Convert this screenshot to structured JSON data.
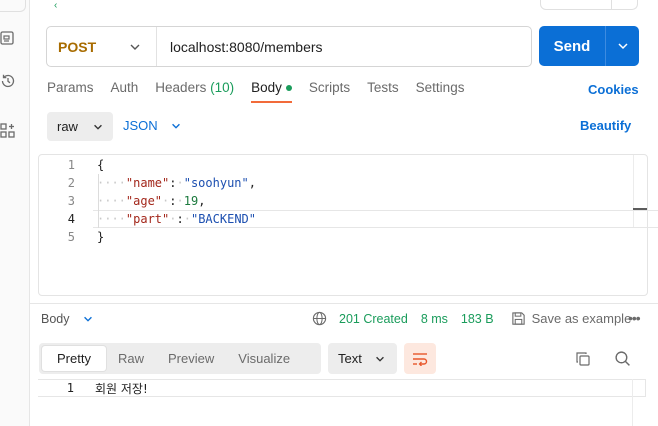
{
  "request": {
    "method": "POST",
    "url": "localhost:8080/members",
    "send_label": "Send"
  },
  "tabs": [
    {
      "label": "Params"
    },
    {
      "label": "Auth"
    },
    {
      "label": "Headers",
      "count": "(10)"
    },
    {
      "label": "Body"
    },
    {
      "label": "Scripts"
    },
    {
      "label": "Tests"
    },
    {
      "label": "Settings"
    }
  ],
  "cookies_label": "Cookies",
  "body_options": {
    "mode": "raw",
    "language": "JSON",
    "beautify_label": "Beautify"
  },
  "editor": {
    "line_numbers": [
      "1",
      "2",
      "3",
      "4",
      "5"
    ],
    "open_brace": "{",
    "close_brace": "}",
    "fields": [
      {
        "key": "\"name\"",
        "value": "\"soohyun\"",
        "comma": ","
      },
      {
        "key": "\"age\"",
        "value": "19",
        "comma": ","
      },
      {
        "key": "\"part\"",
        "value": "\"BACKEND\"",
        "comma": ""
      }
    ]
  },
  "response": {
    "title": "Body",
    "status": "201 Created",
    "time": "8 ms",
    "size": "183 B",
    "save_example_label": "Save as example",
    "view_tabs": [
      "Pretty",
      "Raw",
      "Preview",
      "Visualize"
    ],
    "format": "Text",
    "line_number": "1",
    "body_text": "회원 저장!"
  },
  "colors": {
    "accent_blue": "#0b6fd6",
    "method_post": "#a86c00",
    "status_green": "#1a9c5b",
    "active_tab_underline": "#f26b3a"
  }
}
